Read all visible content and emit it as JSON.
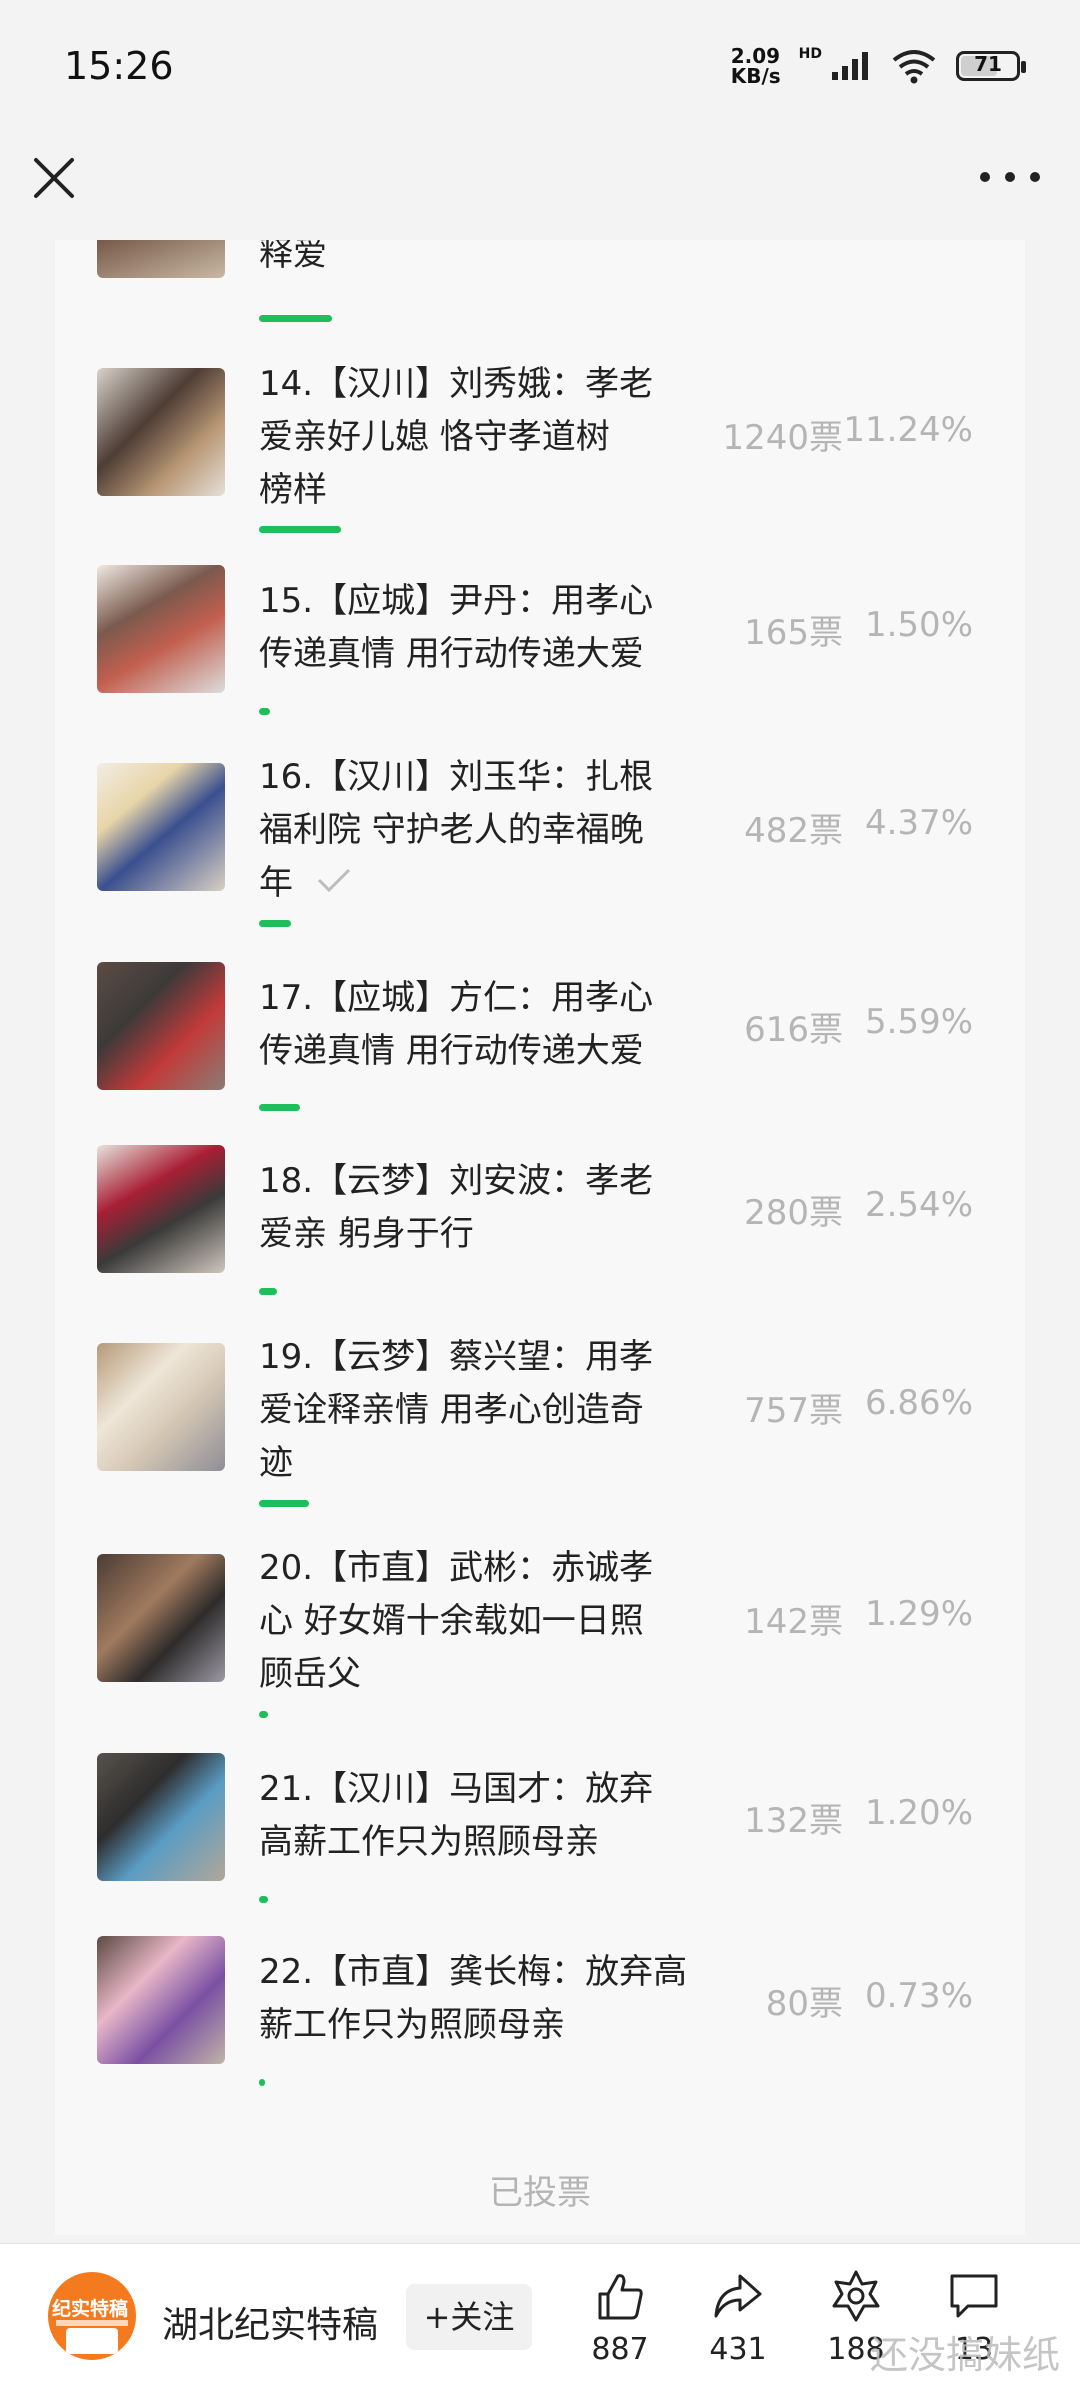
{
  "status_bar": {
    "time": "15:26",
    "net_speed_value": "2.09",
    "net_speed_unit": "KB/s",
    "network_type": "HD",
    "battery": "71"
  },
  "candidates": [
    {
      "title_lines": [
        "释爱"
      ],
      "votes": "",
      "percent": "",
      "share": 0.1,
      "checked": false
    },
    {
      "title_lines": [
        "14.【汉川】刘秀娥：孝老",
        "爱亲好儿媳 恪守孝道树",
        "榜样"
      ],
      "votes": "1240票",
      "percent": "11.24%",
      "share": 0.1124,
      "checked": false
    },
    {
      "title_lines": [
        "15.【应城】尹丹：用孝心",
        "传递真情 用行动传递大爱"
      ],
      "votes": "165票",
      "percent": "1.50%",
      "share": 0.015,
      "checked": false
    },
    {
      "title_lines": [
        "16.【汉川】刘玉华：扎根",
        "福利院 守护老人的幸福晚",
        "年"
      ],
      "votes": "482票",
      "percent": "4.37%",
      "share": 0.0437,
      "checked": true
    },
    {
      "title_lines": [
        "17.【应城】方仁：用孝心",
        "传递真情 用行动传递大爱"
      ],
      "votes": "616票",
      "percent": "5.59%",
      "share": 0.0559,
      "checked": false
    },
    {
      "title_lines": [
        "18.【云梦】刘安波：孝老",
        "爱亲 躬身于行"
      ],
      "votes": "280票",
      "percent": "2.54%",
      "share": 0.0254,
      "checked": false
    },
    {
      "title_lines": [
        "19.【云梦】蔡兴望：用孝",
        "爱诠释亲情 用孝心创造奇",
        "迹"
      ],
      "votes": "757票",
      "percent": "6.86%",
      "share": 0.0686,
      "checked": false
    },
    {
      "title_lines": [
        "20.【市直】武彬：赤诚孝",
        "心 好女婿十余载如一日照",
        "顾岳父"
      ],
      "votes": "142票",
      "percent": "1.29%",
      "share": 0.0129,
      "checked": false
    },
    {
      "title_lines": [
        "21.【汉川】马国才：放弃",
        "高薪工作只为照顾母亲"
      ],
      "votes": "132票",
      "percent": "1.20%",
      "share": 0.012,
      "checked": false
    },
    {
      "title_lines": [
        "22.【市直】龚长梅：放弃高",
        "薪工作只为照顾母亲"
      ],
      "votes": "80票",
      "percent": "0.73%",
      "share": 0.0073,
      "checked": false
    }
  ],
  "voted_label": "已投票",
  "bottom_bar": {
    "logo_text": "纪实特稿",
    "account_name": "湖北纪实特稿",
    "follow_label": "+关注",
    "like_count": "887",
    "share_count": "431",
    "recommend_count": "188",
    "comment_count": "13",
    "watermark": "还没搞妹纸"
  },
  "colors": {
    "accent_green": "#1dbf5a",
    "muted_text": "#b5b5b5",
    "logo_orange": "#f47a1f"
  }
}
